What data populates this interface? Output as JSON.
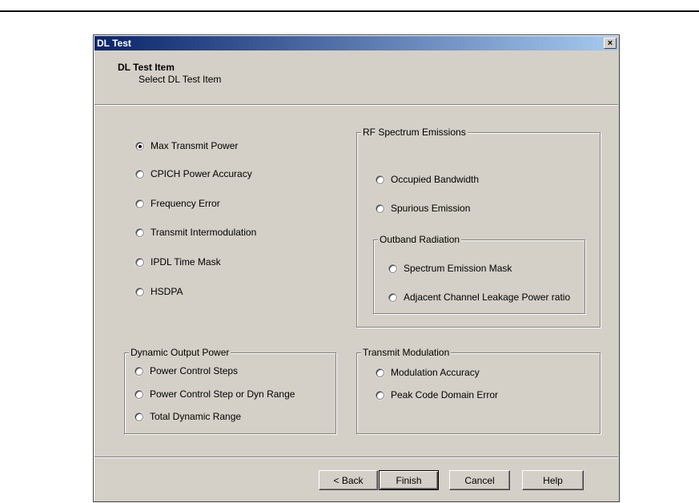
{
  "dialog": {
    "title": "DL Test",
    "close_label": "×"
  },
  "header": {
    "title": "DL Test Item",
    "subtitle": "Select DL Test Item"
  },
  "left_options": [
    {
      "label": "Max Transmit Power",
      "selected": true
    },
    {
      "label": "CPICH Power Accuracy",
      "selected": false
    },
    {
      "label": "Frequency Error",
      "selected": false
    },
    {
      "label": "Transmit Intermodulation",
      "selected": false
    },
    {
      "label": "IPDL Time Mask",
      "selected": false
    },
    {
      "label": "HSDPA",
      "selected": false
    }
  ],
  "rf_spectrum": {
    "label": "RF Spectrum Emissions",
    "options": [
      "Occupied Bandwidth",
      "Spurious Emission"
    ],
    "outband": {
      "label": "Outband Radiation",
      "options": [
        "Spectrum Emission Mask",
        "Adjacent Channel Leakage Power ratio"
      ]
    }
  },
  "dynamic_output": {
    "label": "Dynamic Output Power",
    "options": [
      "Power Control Steps",
      "Power Control Step or Dyn Range",
      "Total Dynamic Range"
    ]
  },
  "transmit_modulation": {
    "label": "Transmit Modulation",
    "options": [
      "Modulation Accuracy",
      "Peak Code Domain Error"
    ]
  },
  "buttons": {
    "back": "< Back",
    "finish": "Finish",
    "cancel": "Cancel",
    "help": "Help"
  }
}
